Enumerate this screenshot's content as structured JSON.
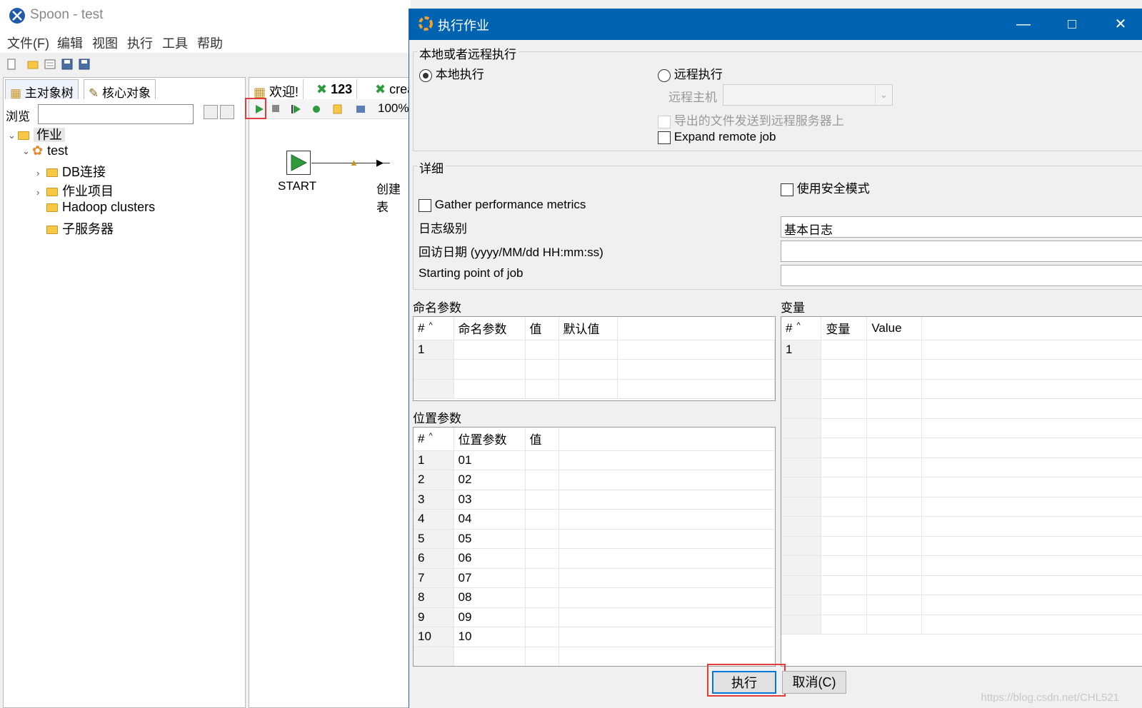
{
  "app": {
    "title": "Spoon - test",
    "menu": [
      "文件(F)",
      "编辑",
      "视图",
      "执行",
      "工具",
      "帮助"
    ]
  },
  "left_panel": {
    "tabs": [
      "主对象树",
      "核心对象"
    ],
    "browse_label": "浏览",
    "tree": [
      {
        "label": "作业",
        "level": 0,
        "expanded": true
      },
      {
        "label": "test",
        "level": 1,
        "expanded": true
      },
      {
        "label": "DB连接",
        "level": 2,
        "expanded": false
      },
      {
        "label": "作业项目",
        "level": 2,
        "expanded": false
      },
      {
        "label": "Hadoop clusters",
        "level": 2
      },
      {
        "label": "子服务器",
        "level": 2
      }
    ]
  },
  "canvas": {
    "tabs": [
      "欢迎!",
      "123",
      "crea"
    ],
    "zoom": "100%",
    "start_label": "START",
    "create_label": "创建表"
  },
  "dialog": {
    "title": "执行作业",
    "exec_group": {
      "title": "本地或者远程执行",
      "local": "本地执行",
      "remote": "远程执行",
      "selected": "local",
      "remote_host_label": "远程主机",
      "send_files_label": "导出的文件发送到远程服务器上",
      "expand_remote_label": "Expand remote job"
    },
    "details": {
      "title": "详细",
      "safe_mode": "使用安全模式",
      "gather_metrics": "Gather performance metrics",
      "log_level_label": "日志级别",
      "log_level_value": "基本日志",
      "replay_date_label": "回访日期 (yyyy/MM/dd HH:mm:ss)",
      "start_point_label": "Starting point of job"
    },
    "named_params": {
      "title": "命名参数",
      "columns": [
        "#",
        "命名参数",
        "值",
        "默认值"
      ],
      "rows": [
        [
          "1",
          "",
          "",
          ""
        ],
        [
          "",
          "",
          "",
          ""
        ],
        [
          "",
          "",
          "",
          ""
        ]
      ]
    },
    "positional_params": {
      "title": "位置参数",
      "columns": [
        "#",
        "位置参数",
        "值"
      ],
      "rows": [
        [
          "1",
          "01",
          ""
        ],
        [
          "2",
          "02",
          ""
        ],
        [
          "3",
          "03",
          ""
        ],
        [
          "4",
          "04",
          ""
        ],
        [
          "5",
          "05",
          ""
        ],
        [
          "6",
          "06",
          ""
        ],
        [
          "7",
          "07",
          ""
        ],
        [
          "8",
          "08",
          ""
        ],
        [
          "9",
          "09",
          ""
        ],
        [
          "10",
          "10",
          ""
        ],
        [
          "",
          "",
          ""
        ]
      ]
    },
    "variables": {
      "title": "变量",
      "columns": [
        "#",
        "变量",
        "Value"
      ],
      "rows": [
        [
          "1",
          "",
          ""
        ],
        [
          "",
          "",
          ""
        ],
        [
          "",
          "",
          ""
        ],
        [
          "",
          "",
          ""
        ],
        [
          "",
          "",
          ""
        ],
        [
          "",
          "",
          ""
        ],
        [
          "",
          "",
          ""
        ],
        [
          "",
          "",
          ""
        ],
        [
          "",
          "",
          ""
        ],
        [
          "",
          "",
          ""
        ],
        [
          "",
          "",
          ""
        ],
        [
          "",
          "",
          ""
        ],
        [
          "",
          "",
          ""
        ],
        [
          "",
          "",
          ""
        ],
        [
          "",
          "",
          ""
        ]
      ]
    },
    "buttons": {
      "execute": "执行",
      "cancel": "取消(C)"
    }
  },
  "watermark": "https://blog.csdn.net/CHL521",
  "colors": {
    "dialog_title_bar": "#0063b1",
    "highlight": "#e23b3b"
  }
}
